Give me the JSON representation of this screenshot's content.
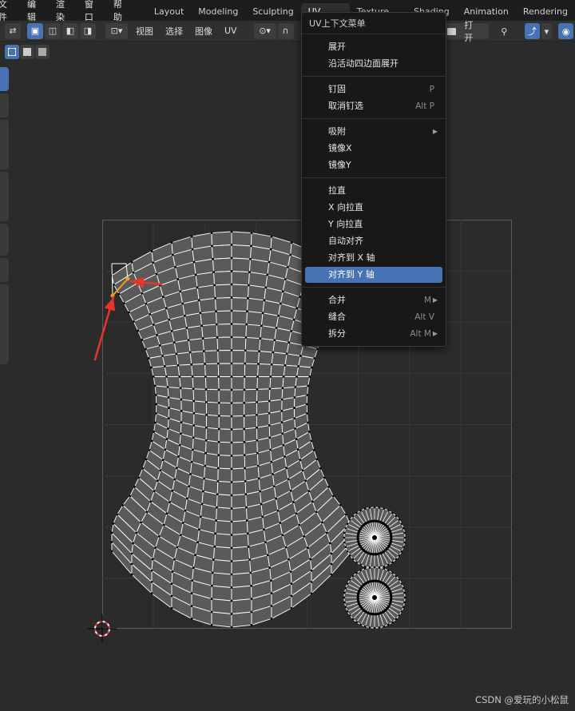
{
  "menubar": {
    "items": [
      "文件",
      "编辑",
      "渲染",
      "窗口",
      "帮助"
    ],
    "workspaces": [
      "Layout",
      "Modeling",
      "Sculpting",
      "UV Editing",
      "Texture Paint",
      "Shading",
      "Animation",
      "Rendering"
    ],
    "active_workspace": "UV Editing"
  },
  "header": {
    "menus": [
      "视图",
      "选择",
      "图像",
      "UV"
    ],
    "open_label": "打开"
  },
  "context_menu": {
    "title": "UV上下文菜单",
    "groups": [
      [
        {
          "label": "展开",
          "shortcut": ""
        },
        {
          "label": "沿活动四边面展开",
          "shortcut": ""
        }
      ],
      [
        {
          "label": "钉固",
          "shortcut": "P"
        },
        {
          "label": "取消钉选",
          "shortcut": "Alt P"
        }
      ],
      [
        {
          "label": "吸附",
          "shortcut": "",
          "submenu": true
        },
        {
          "label": "镜像X",
          "shortcut": ""
        },
        {
          "label": "镜像Y",
          "shortcut": ""
        }
      ],
      [
        {
          "label": "拉直",
          "shortcut": ""
        },
        {
          "label": "X 向拉直",
          "shortcut": ""
        },
        {
          "label": "Y 向拉直",
          "shortcut": ""
        },
        {
          "label": "自动对齐",
          "shortcut": ""
        },
        {
          "label": "对齐到 X 轴",
          "shortcut": ""
        },
        {
          "label": "对齐到 Y 轴",
          "shortcut": "",
          "active": true
        }
      ],
      [
        {
          "label": "合并",
          "shortcut": "M",
          "submenu": true
        },
        {
          "label": "缝合",
          "shortcut": "Alt V"
        },
        {
          "label": "拆分",
          "shortcut": "Alt M",
          "submenu": true
        }
      ]
    ]
  },
  "colors": {
    "accent": "#4772b3",
    "arrow": "#e8352c",
    "selected_edge": "#f59a23"
  },
  "watermark": "CSDN @爱玩的小松鼠"
}
